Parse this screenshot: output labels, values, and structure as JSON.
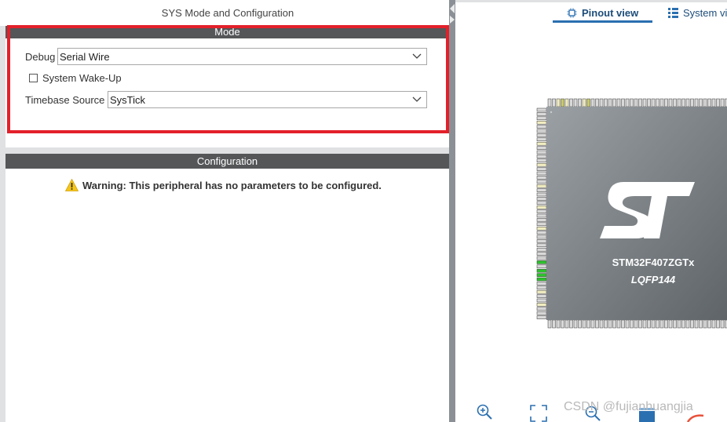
{
  "left_panel": {
    "title": "SYS Mode and Configuration",
    "mode": {
      "header": "Mode",
      "debug": {
        "label": "Debug",
        "value": "Serial Wire"
      },
      "wakeup": {
        "label": "System Wake-Up",
        "checked": false
      },
      "timebase": {
        "label": "Timebase Source",
        "value": "SysTick"
      }
    },
    "configuration": {
      "header": "Configuration",
      "warning": "Warning: This peripheral has no parameters to be configured."
    }
  },
  "right_panel": {
    "tabs": [
      {
        "label": "Pinout view",
        "icon": "chip-icon",
        "active": true
      },
      {
        "label": "System view",
        "icon": "grid-icon",
        "active": false
      }
    ],
    "chip": {
      "part_number": "STM32F407ZGTx",
      "package": "LQFP144",
      "logo": "ST"
    },
    "toolbar": [
      {
        "icon": "zoom-in-icon"
      },
      {
        "icon": "fit-screen-icon"
      },
      {
        "icon": "zoom-out-icon"
      }
    ],
    "watermark": "CSDN @fujianhuangjia"
  },
  "colors": {
    "highlight": "#e3202a",
    "header_bg": "#545658",
    "tab_accent": "#2a6fb0",
    "chip_body": "#7e8387",
    "pin_assigned": "#2dc22d",
    "pin_power": "#f1edc1"
  }
}
